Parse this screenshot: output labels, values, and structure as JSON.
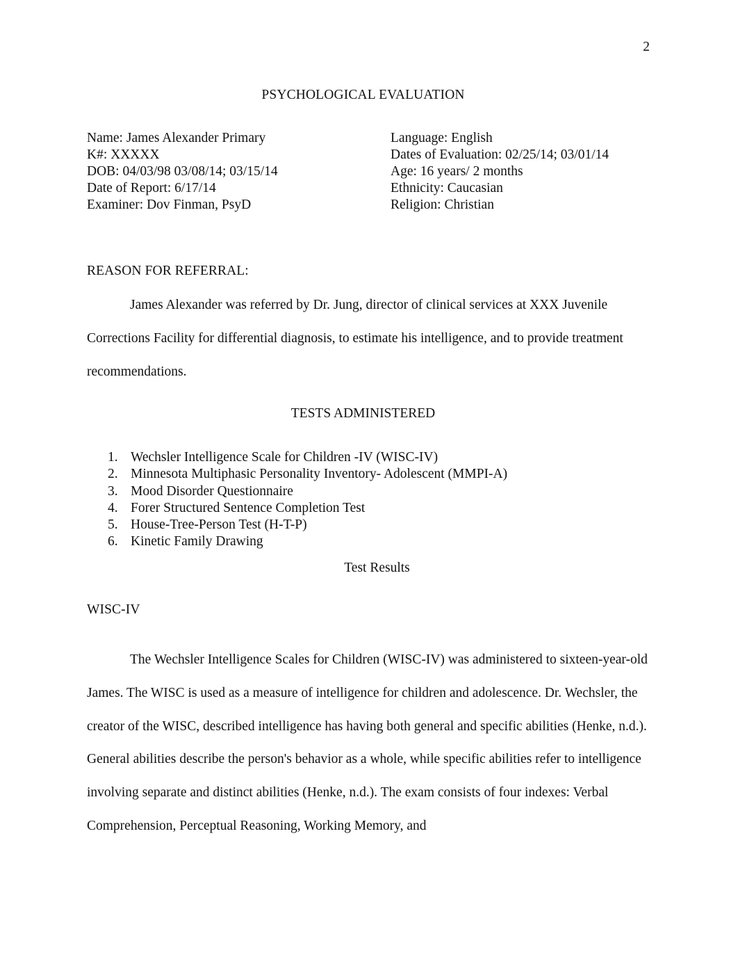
{
  "page": {
    "number": "2",
    "title": "PSYCHOLOGICAL EVALUATION"
  },
  "info": {
    "left": [
      "Name:  James Alexander Primary",
      "K#: XXXXX",
      "DOB: 04/03/98 03/08/14; 03/15/14",
      "Date of Report:   6/17/14",
      "Examiner:  Dov Finman, PsyD"
    ],
    "right": [
      "Language:   English",
      "Dates of Evaluation:   02/25/14; 03/01/14",
      "Age:  16 years/ 2 months",
      "Ethnicity:   Caucasian",
      "Religion:  Christian"
    ]
  },
  "reason_for_referral": {
    "heading": "REASON FOR REFERRAL:",
    "paragraph": "James Alexander was referred by Dr. Jung, director of clinical services at XXX Juvenile Corrections Facility for differential diagnosis, to estimate his intelligence, and to provide treatment recommendations."
  },
  "tests_administered": {
    "heading": "TESTS ADMINISTERED",
    "items": [
      {
        "number": "1.",
        "label": "Wechsler Intelligence Scale for Children -IV (WISC-IV)"
      },
      {
        "number": "2.",
        "label": "Minnesota Multiphasic Personality Inventory- Adolescent (MMPI-A)"
      },
      {
        "number": "3.",
        "label": "Mood Disorder Questionnaire"
      },
      {
        "number": "4.",
        "label": "Forer Structured Sentence Completion Test"
      },
      {
        "number": "5.",
        "label": "House-Tree-Person Test (H-T-P)"
      },
      {
        "number": "6.",
        "label": "Kinetic Family Drawing"
      }
    ]
  },
  "test_results": {
    "heading": "Test Results",
    "subheading": "WISC-IV",
    "paragraph": "The Wechsler Intelligence Scales for Children (WISC-IV) was administered to sixteen-year-old James. The WISC is used as a measure of intelligence for children and adolescence. Dr. Wechsler, the creator of the WISC, described intelligence has having both general and specific abilities (Henke, n.d.). General abilities describe the person's behavior as a whole, while specific abilities refer to intelligence involving separate and distinct abilities (Henke, n.d.). The exam consists of four indexes: Verbal Comprehension, Perceptual Reasoning, Working Memory, and"
  }
}
